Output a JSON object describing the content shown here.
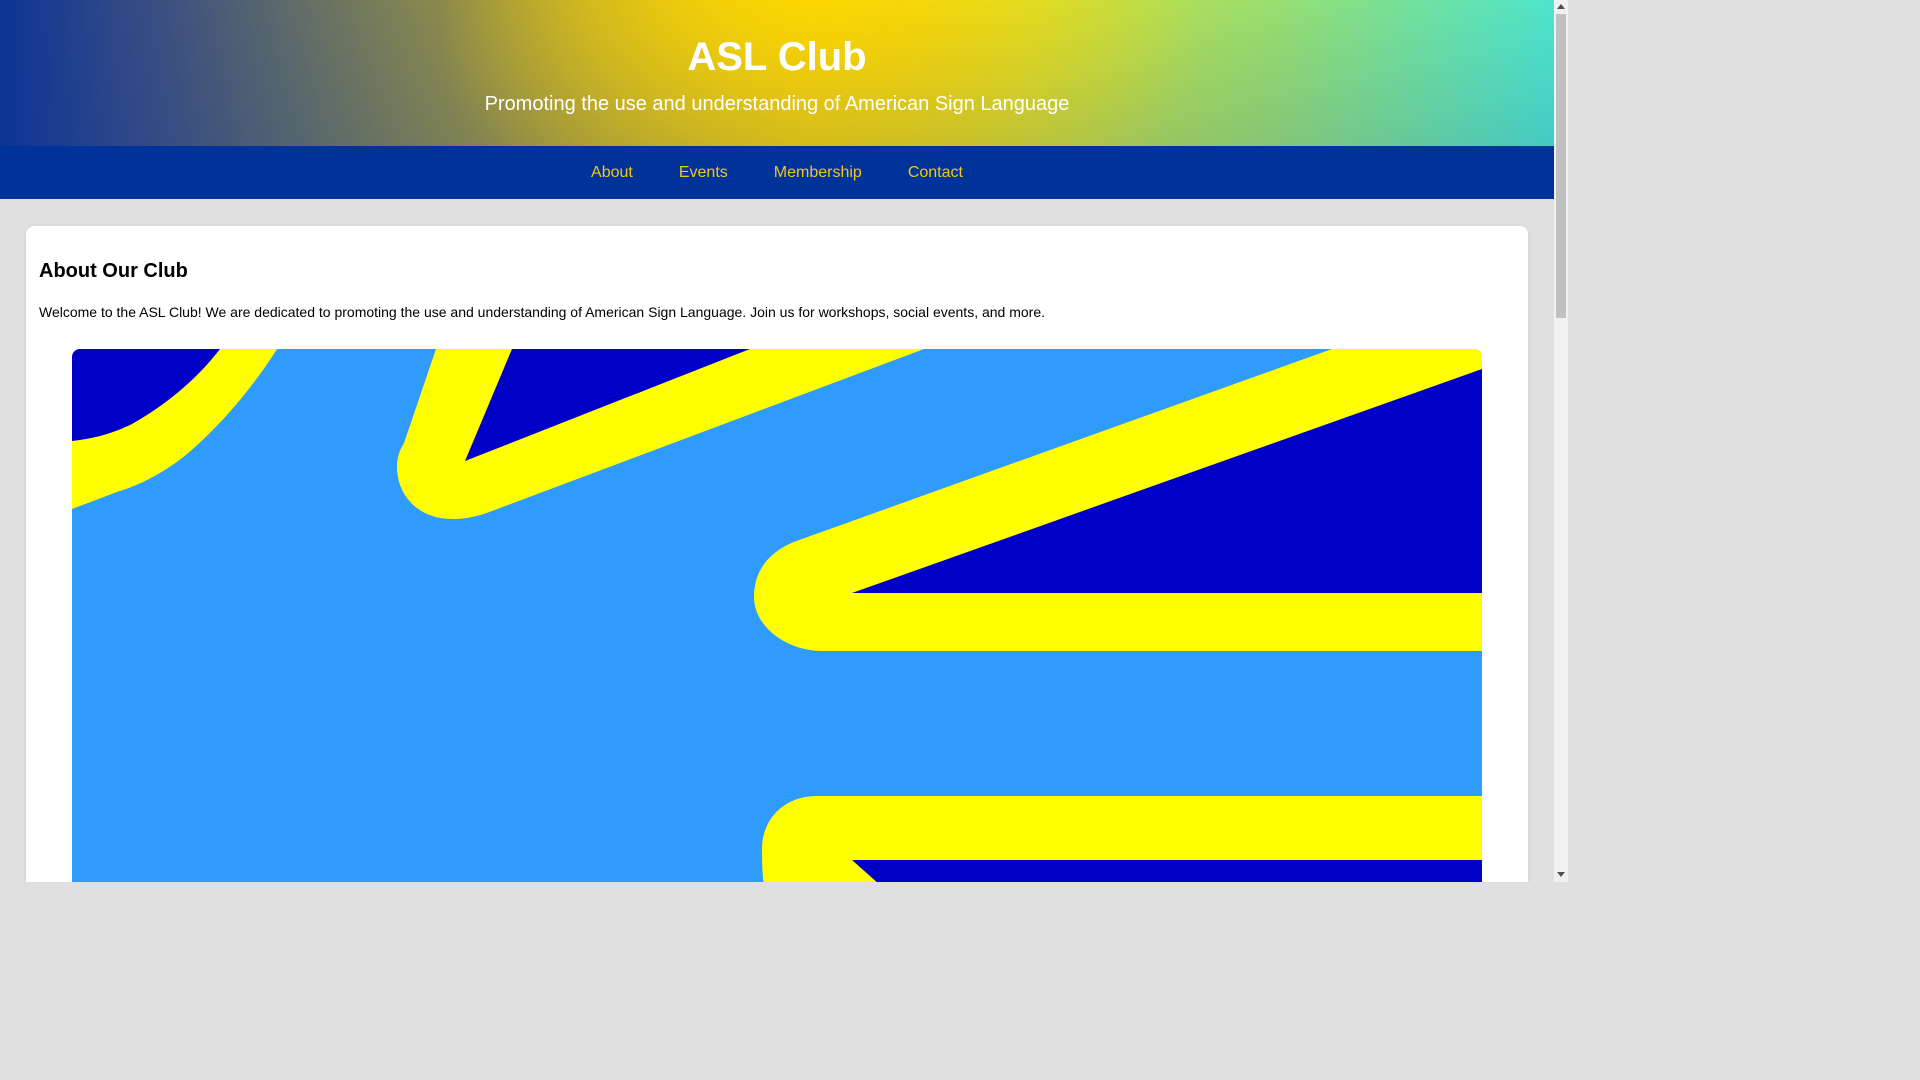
{
  "header": {
    "title": "ASL Club",
    "tagline": "Promoting the use and understanding of American Sign Language"
  },
  "nav": {
    "items": [
      {
        "label": "About"
      },
      {
        "label": "Events"
      },
      {
        "label": "Membership"
      },
      {
        "label": "Contact"
      }
    ]
  },
  "about": {
    "heading": "About Our Club",
    "body": "Welcome to the ASL Club! We are dedicated to promoting the use and understanding of American Sign Language. Join us for workshops, social events, and more."
  },
  "image": {
    "icon": "asl-hand-sign-illustration",
    "colors": {
      "background": "#2f9bfd",
      "outline": "#ffff00",
      "fill": "#0000c8"
    }
  },
  "theme": {
    "nav_bg": "#00339a",
    "nav_link": "#f5c518",
    "page_bg": "#e0e0e0"
  }
}
